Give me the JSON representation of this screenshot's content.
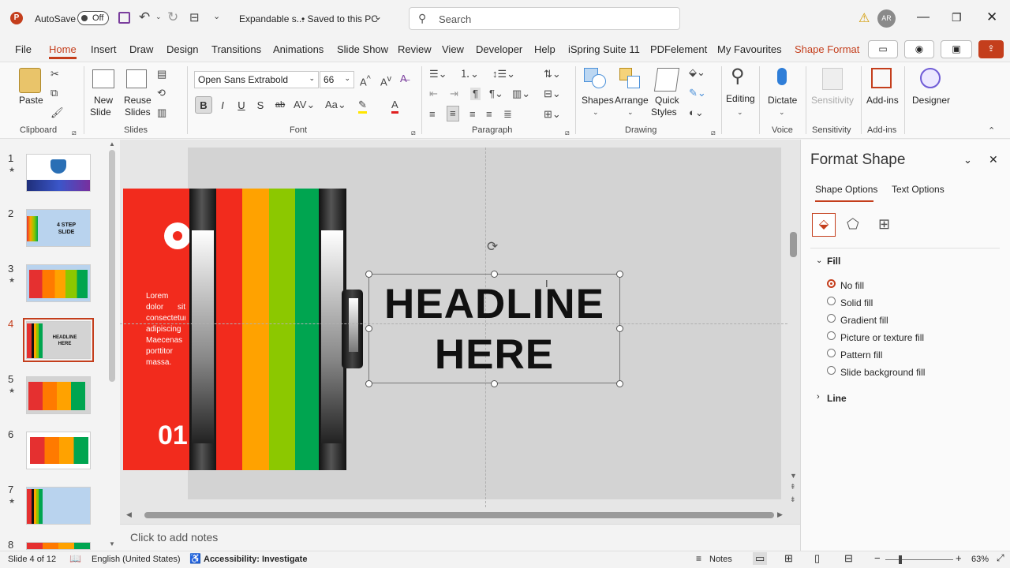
{
  "titlebar": {
    "autosave_label": "AutoSave",
    "autosave_state": "Off",
    "doc_title": "Expandable s...",
    "save_status": "• Saved to this PC",
    "search_placeholder": "Search",
    "user_initials": "AR"
  },
  "tabs": [
    "File",
    "Home",
    "Insert",
    "Draw",
    "Design",
    "Transitions",
    "Animations",
    "Slide Show",
    "Review",
    "View",
    "Developer",
    "Help",
    "iSpring Suite 11",
    "PDFelement",
    "My Favourites",
    "Shape Format"
  ],
  "ribbon": {
    "clipboard": {
      "paste": "Paste",
      "label": "Clipboard"
    },
    "slides": {
      "new_slide": [
        "New",
        "Slide"
      ],
      "reuse": [
        "Reuse",
        "Slides"
      ],
      "label": "Slides"
    },
    "font": {
      "name": "Open Sans Extrabold",
      "size": "66",
      "label": "Font",
      "bold": "B",
      "italic": "I",
      "underline": "U",
      "shadow": "S",
      "strike": "ab"
    },
    "paragraph": {
      "label": "Paragraph"
    },
    "drawing": {
      "shapes": "Shapes",
      "arrange": "Arrange",
      "quick": [
        "Quick",
        "Styles"
      ],
      "label": "Drawing"
    },
    "editing": {
      "label": "Editing"
    },
    "voice": {
      "dictate": "Dictate",
      "label": "Voice"
    },
    "sensitivity": {
      "btn": "Sensitivity",
      "label": "Sensitivity"
    },
    "addins": {
      "btn": "Add-ins",
      "label": "Add-ins"
    },
    "designer": {
      "btn": "Designer"
    }
  },
  "thumbs": [
    {
      "num": "1",
      "star": true,
      "text": ""
    },
    {
      "num": "2",
      "star": false,
      "text": "4 STEP SLIDE"
    },
    {
      "num": "3",
      "star": true,
      "text": ""
    },
    {
      "num": "4",
      "star": false,
      "text": "HEADLINE HERE"
    },
    {
      "num": "5",
      "star": true,
      "text": ""
    },
    {
      "num": "6",
      "star": false,
      "text": ""
    },
    {
      "num": "7",
      "star": true,
      "text": ""
    },
    {
      "num": "8",
      "star": false,
      "text": ""
    }
  ],
  "slide": {
    "body_text": "Lorem dolor sit consectetur adipiscing Maecenas porttitor massa.",
    "number": "01",
    "headline_1": "HEADLINE",
    "headline_2": "HERE"
  },
  "notes_placeholder": "Click to add notes",
  "format_pane": {
    "title": "Format Shape",
    "tab_shape": "Shape Options",
    "tab_text": "Text Options",
    "fill_header": "Fill",
    "line_header": "Line",
    "options": [
      "No fill",
      "Solid fill",
      "Gradient fill",
      "Picture or texture fill",
      "Pattern fill",
      "Slide background fill"
    ],
    "selected_option": "No fill"
  },
  "status": {
    "slide_info": "Slide 4 of 12",
    "language": "English (United States)",
    "accessibility": "Accessibility: Investigate",
    "notes": "Notes",
    "zoom": "63%"
  },
  "colors": {
    "accent": "#c43e1c",
    "stripe_red": "#f22b1d",
    "stripe_orange": "#ffa200",
    "stripe_lime": "#8cc800",
    "stripe_green": "#00a550",
    "slide_bg": "#d3d3d3"
  }
}
